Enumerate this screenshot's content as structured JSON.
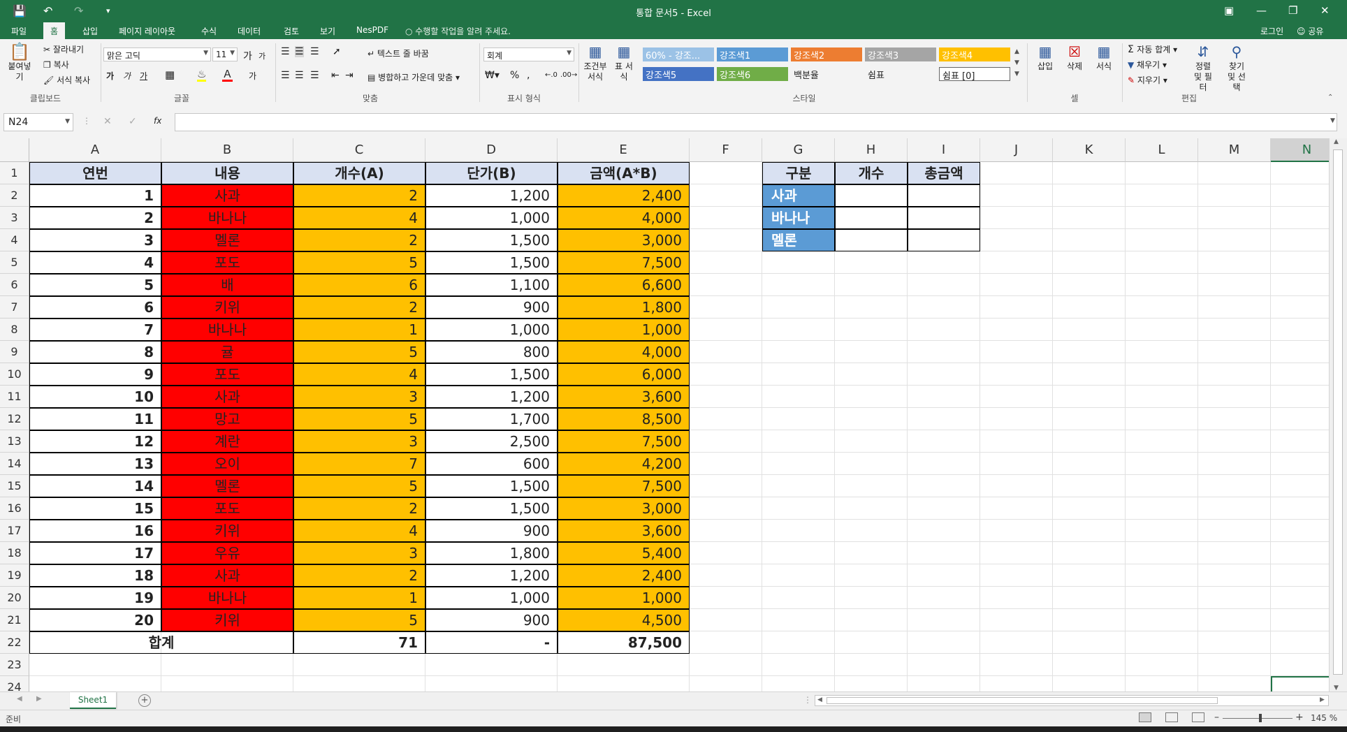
{
  "window": {
    "title": "통합 문서5 - Excel",
    "login": "로그인",
    "share": "공유"
  },
  "tabs": [
    "파일",
    "홈",
    "삽입",
    "페이지 레이아웃",
    "수식",
    "데이터",
    "검토",
    "보기",
    "NesPDF"
  ],
  "tell_me": "수행할 작업을 알려 주세요.",
  "ribbon": {
    "clipboard": {
      "paste": "붙여넣기",
      "cut": "잘라내기",
      "copy": "복사",
      "format_painter": "서식 복사",
      "label": "클립보드"
    },
    "font": {
      "name": "맑은 고딕",
      "size": "11",
      "grow": "가",
      "shrink": "가",
      "bold": "가",
      "italic": "가",
      "underline": "가",
      "label": "글꼴"
    },
    "align": {
      "wrap": "텍스트 줄 바꿈",
      "merge": "병합하고 가운데 맞춤",
      "label": "맞춤"
    },
    "number": {
      "format": "회계",
      "percent": "%",
      "comma": ",",
      "label": "표시 형식"
    },
    "styles": {
      "cond_format": "조건부 서식",
      "table_format": "표 서식",
      "cells": [
        {
          "text": "60% - 강조...",
          "bg": "#9bc2e6",
          "fg": "#ffffff"
        },
        {
          "text": "강조색1",
          "bg": "#5b9bd5",
          "fg": "#ffffff"
        },
        {
          "text": "강조색2",
          "bg": "#ed7d31",
          "fg": "#ffffff"
        },
        {
          "text": "강조색3",
          "bg": "#a5a5a5",
          "fg": "#ffffff"
        },
        {
          "text": "강조색4",
          "bg": "#ffc000",
          "fg": "#ffffff"
        },
        {
          "text": "강조색5",
          "bg": "#4472c4",
          "fg": "#ffffff"
        },
        {
          "text": "강조색6",
          "bg": "#70ad47",
          "fg": "#ffffff"
        },
        {
          "text": "백분율",
          "bg": "#f3f3f3",
          "fg": "#222222"
        },
        {
          "text": "쉼표",
          "bg": "#f3f3f3",
          "fg": "#222222"
        },
        {
          "text": "쉼표 [0]",
          "bg": "#ffffff",
          "fg": "#222222"
        }
      ],
      "label": "스타일"
    },
    "cells_grp": {
      "insert": "삽입",
      "delete": "삭제",
      "format": "서식",
      "label": "셀"
    },
    "editing": {
      "autosum": "자동 합계",
      "fill": "채우기",
      "clear": "지우기",
      "sort": "정렬 및 필터",
      "find": "찾기 및 선택",
      "label": "편집"
    }
  },
  "formula_bar": {
    "name_box": "N24",
    "fx": "fx",
    "value": ""
  },
  "columns": [
    "A",
    "B",
    "C",
    "D",
    "E",
    "F",
    "G",
    "H",
    "I",
    "J",
    "K",
    "L",
    "M",
    "N"
  ],
  "rows": [
    "1",
    "2",
    "3",
    "4",
    "5",
    "6",
    "7",
    "8",
    "9",
    "10",
    "11",
    "12",
    "13",
    "14",
    "15",
    "16",
    "17",
    "18",
    "19",
    "20",
    "21",
    "22",
    "23",
    "24"
  ],
  "table": {
    "headers": [
      "연번",
      "내용",
      "개수(A)",
      "단가(B)",
      "금액(A*B)"
    ],
    "rows": [
      [
        "1",
        "사과",
        "2",
        "1,200",
        "2,400"
      ],
      [
        "2",
        "바나나",
        "4",
        "1,000",
        "4,000"
      ],
      [
        "3",
        "멜론",
        "2",
        "1,500",
        "3,000"
      ],
      [
        "4",
        "포도",
        "5",
        "1,500",
        "7,500"
      ],
      [
        "5",
        "배",
        "6",
        "1,100",
        "6,600"
      ],
      [
        "6",
        "키위",
        "2",
        "900",
        "1,800"
      ],
      [
        "7",
        "바나나",
        "1",
        "1,000",
        "1,000"
      ],
      [
        "8",
        "귤",
        "5",
        "800",
        "4,000"
      ],
      [
        "9",
        "포도",
        "4",
        "1,500",
        "6,000"
      ],
      [
        "10",
        "사과",
        "3",
        "1,200",
        "3,600"
      ],
      [
        "11",
        "망고",
        "5",
        "1,700",
        "8,500"
      ],
      [
        "12",
        "계란",
        "3",
        "2,500",
        "7,500"
      ],
      [
        "13",
        "오이",
        "7",
        "600",
        "4,200"
      ],
      [
        "14",
        "멜론",
        "5",
        "1,500",
        "7,500"
      ],
      [
        "15",
        "포도",
        "2",
        "1,500",
        "3,000"
      ],
      [
        "16",
        "키위",
        "4",
        "900",
        "3,600"
      ],
      [
        "17",
        "우유",
        "3",
        "1,800",
        "5,400"
      ],
      [
        "18",
        "사과",
        "2",
        "1,200",
        "2,400"
      ],
      [
        "19",
        "바나나",
        "1",
        "1,000",
        "1,000"
      ],
      [
        "20",
        "키위",
        "5",
        "900",
        "4,500"
      ]
    ],
    "total": {
      "label": "합계",
      "count": "71",
      "price": "-",
      "amount": "87,500"
    }
  },
  "summary": {
    "headers": [
      "구분",
      "개수",
      "총금액"
    ],
    "items": [
      "사과",
      "바나나",
      "멜론"
    ]
  },
  "colors": {
    "red": "#ff0000",
    "orange": "#ffc000",
    "header_blue": "#d9e1f2",
    "label_blue": "#5b9bd5",
    "excel_green": "#217346"
  },
  "sheet": {
    "tab": "Sheet1"
  },
  "status": {
    "ready": "준비",
    "zoom": "145 %"
  }
}
